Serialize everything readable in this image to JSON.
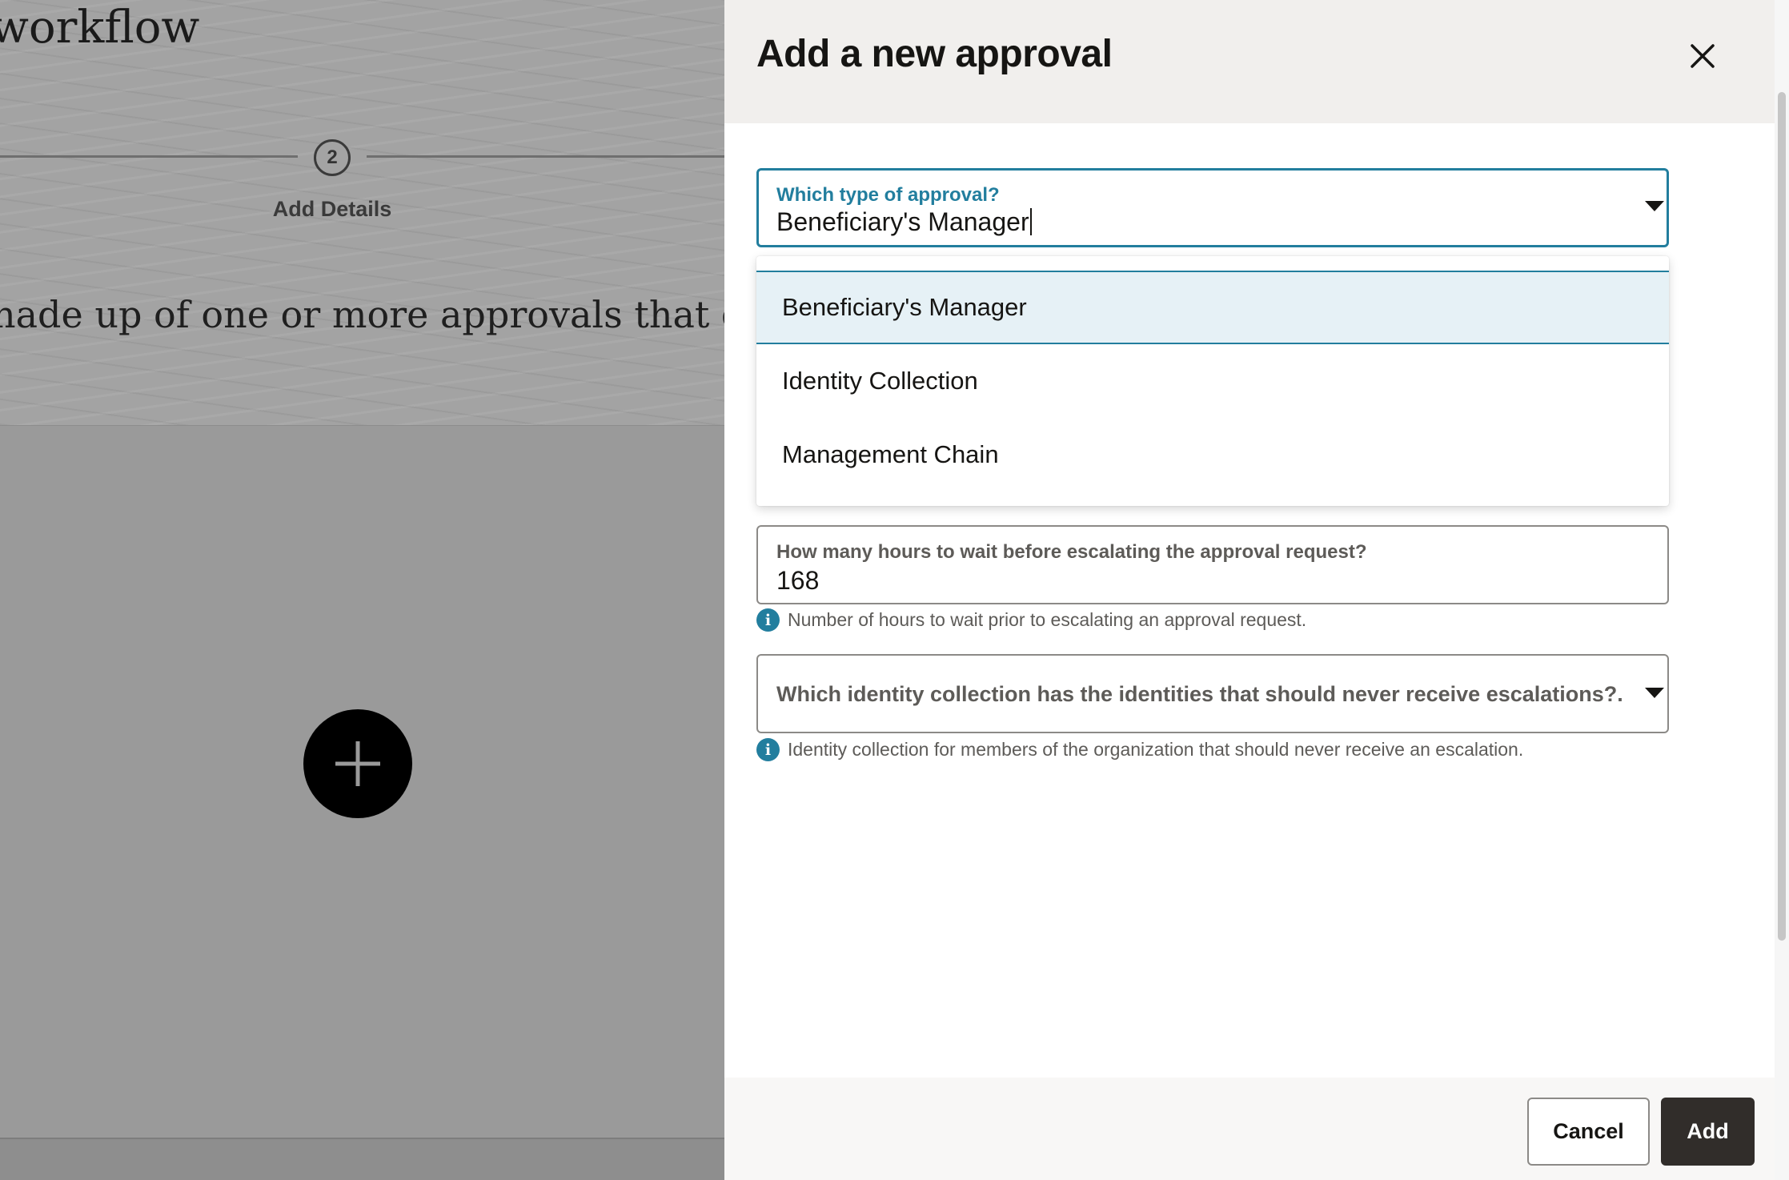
{
  "background": {
    "page_title": "workflow",
    "step": {
      "number": "2",
      "label": "Add Details"
    },
    "description": "nade up of one or more approvals that define"
  },
  "drawer": {
    "title": "Add a new approval",
    "approval_type_field": {
      "label": "Which type of approval?",
      "value": "Beneficiary's Manager",
      "options": [
        "Beneficiary's Manager",
        "Identity Collection",
        "Management Chain"
      ],
      "highlighted_option": "Beneficiary's Manager"
    },
    "escalation_hours_field": {
      "label": "How many hours to wait before escalating the approval request?",
      "value": "168",
      "help": "Number of hours to wait prior to escalating an approval request."
    },
    "no_escalation_collection_field": {
      "placeholder": "Which identity collection has the identities that should never receive escalations?.",
      "help": "Identity collection for members of the organization that should never receive an escalation."
    },
    "footer": {
      "cancel_label": "Cancel",
      "add_label": "Add"
    }
  },
  "colors": {
    "accent": "#227e9e",
    "primary_button": "#312d2a",
    "header_bg": "#f1efed",
    "option_highlight": "#e6f1f6"
  },
  "icons": {
    "close": "close-icon",
    "dropdown": "chevron-down-icon",
    "info": "info-icon",
    "add": "plus-icon"
  }
}
